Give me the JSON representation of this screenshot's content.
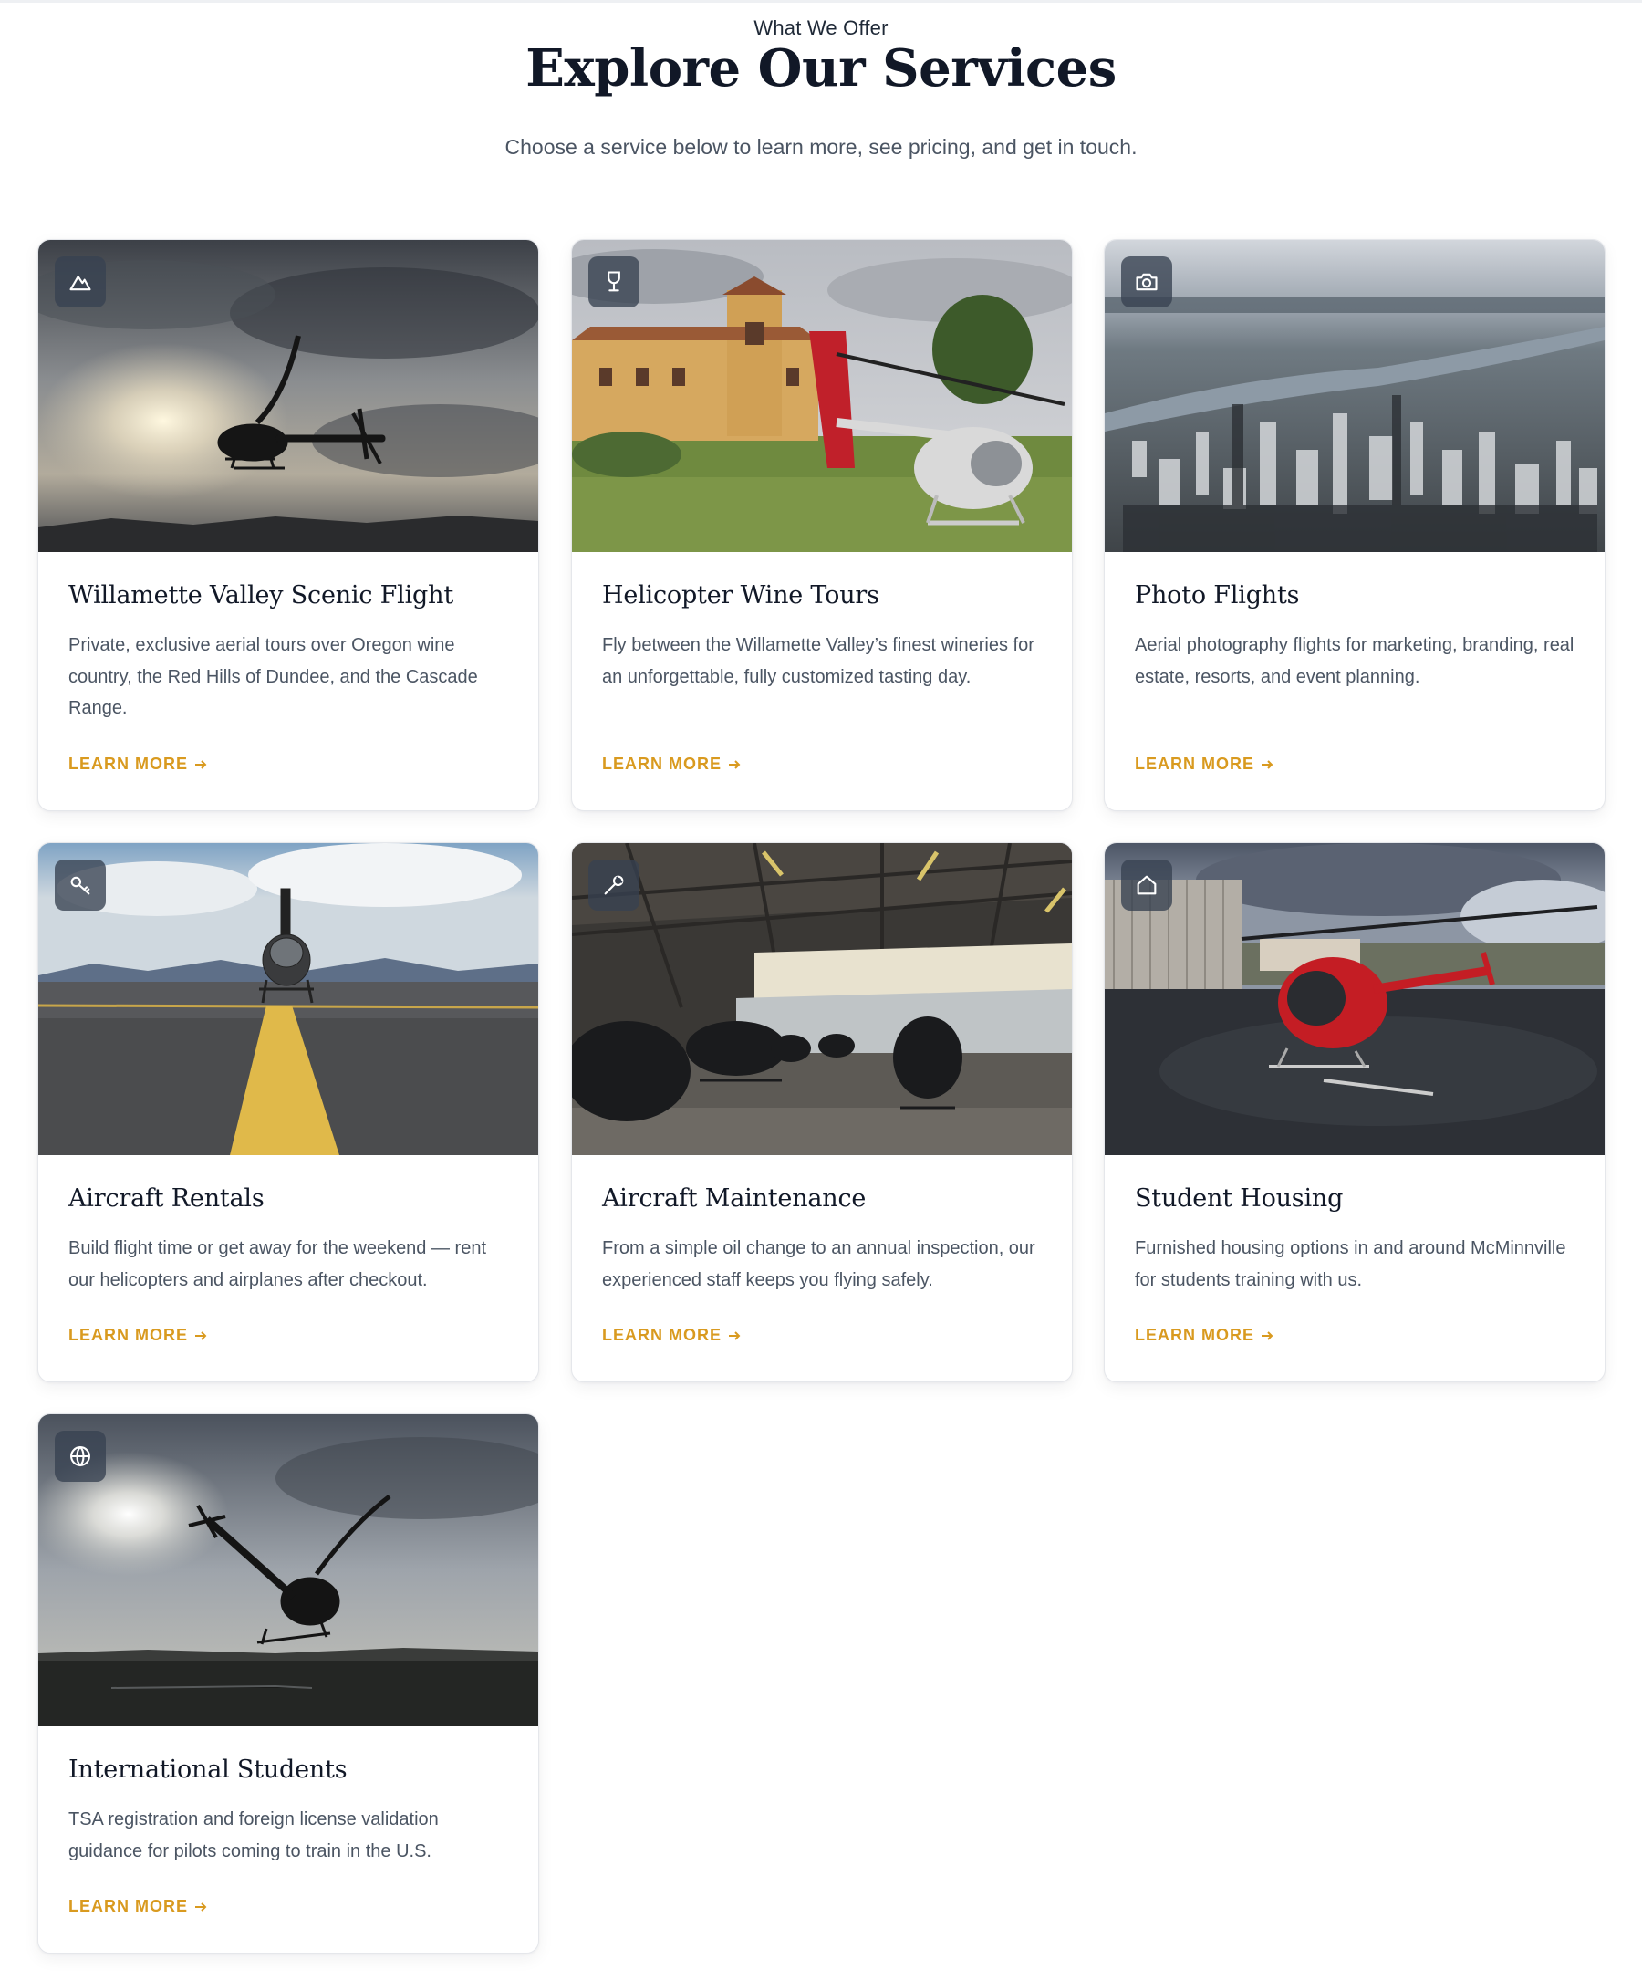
{
  "header": {
    "eyebrow": "What We Offer",
    "title": "Explore Our Services",
    "subtitle": "Choose a service below to learn more, see pricing, and get in touch."
  },
  "colors": {
    "accent": "#d99a1f",
    "heading": "#111827",
    "body_text": "#4b5563",
    "badge_bg": "#374151"
  },
  "cards": [
    {
      "title": "Willamette Valley Scenic Flight",
      "description": "Private, exclusive aerial tours over Oregon wine country, the Red Hills of Dundee, and the Cascade Range.",
      "cta": "LEARN MORE",
      "icon": "mountain-icon",
      "image": "helicopter-silhouette-cloudy-sunset"
    },
    {
      "title": "Helicopter Wine Tours",
      "description": "Fly between the Willamette Valley’s finest wineries for an unforgettable, fully customized tasting day.",
      "cta": "LEARN MORE",
      "icon": "wine-glass-icon",
      "image": "helicopter-at-winery-villa"
    },
    {
      "title": "Photo Flights",
      "description": "Aerial photography flights for marketing, branding, real estate, resorts, and event planning.",
      "cta": "LEARN MORE",
      "icon": "camera-icon",
      "image": "aerial-city-river-view"
    },
    {
      "title": "Aircraft Rentals",
      "description": "Build flight time or get away for the weekend — rent our helicopters and airplanes after checkout.",
      "cta": "LEARN MORE",
      "icon": "key-icon",
      "image": "helicopter-on-runway-centerline"
    },
    {
      "title": "Aircraft Maintenance",
      "description": "From a simple oil change to an annual inspection, our experienced staff keeps you flying safely.",
      "cta": "LEARN MORE",
      "icon": "wrench-icon",
      "image": "helicopters-in-hangar"
    },
    {
      "title": "Student Housing",
      "description": "Furnished housing options in and around McMinnville for students training with us.",
      "cta": "LEARN MORE",
      "icon": "home-icon",
      "image": "red-helicopter-on-wet-ramp"
    },
    {
      "title": "International Students",
      "description": "TSA registration and foreign license validation guidance for pilots coming to train in the U.S.",
      "cta": "LEARN MORE",
      "icon": "globe-icon",
      "image": "helicopter-silhouette-over-field"
    }
  ]
}
